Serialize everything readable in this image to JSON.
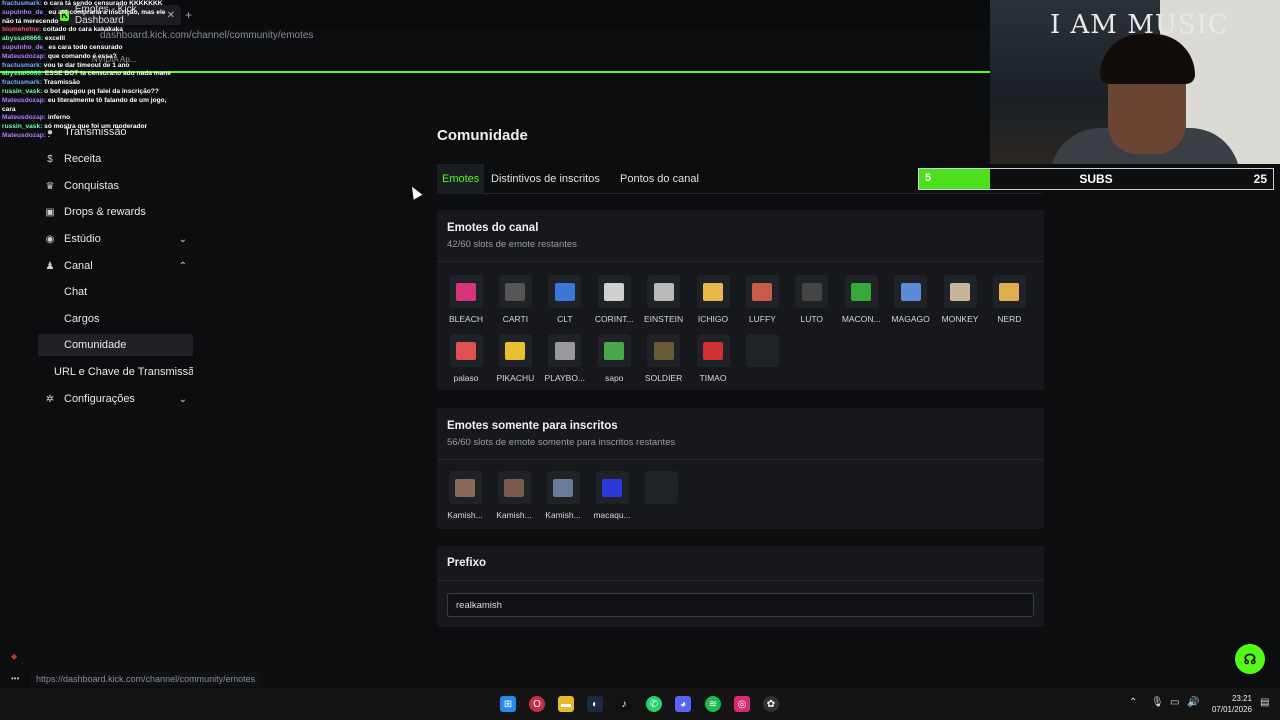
{
  "browser": {
    "tab_title": "Emotes - Kick Dashboard",
    "tab_close": "✕",
    "new_tab": "+",
    "url": "dashboard.kick.com/channel/community/emotes",
    "bookmark": "NVIDIA Ap..."
  },
  "sidebar": {
    "items": [
      {
        "label": "Transmissão",
        "icon": "broadcast-icon"
      },
      {
        "label": "Receita",
        "icon": "money-icon"
      },
      {
        "label": "Conquistas",
        "icon": "trophy-icon"
      },
      {
        "label": "Drops & rewards",
        "icon": "gift-icon"
      },
      {
        "label": "Estúdio",
        "icon": "studio-icon",
        "chevron": "⌄"
      },
      {
        "label": "Canal",
        "icon": "users-icon",
        "chevron": "⌃"
      },
      {
        "label": "Chat"
      },
      {
        "label": "Cargos"
      },
      {
        "label": "Comunidade"
      },
      {
        "label": "URL e Chave de Transmissã"
      },
      {
        "label": "Configurações",
        "icon": "gear-icon",
        "chevron": "⌄"
      }
    ]
  },
  "chat": [
    {
      "user": "fractusmark:",
      "text": "o cara tá sendo censurado KKKKKKK"
    },
    {
      "user": "supulnho_de_",
      "text": "eu até compraria a inscrição, mas ele não tá merecendo"
    },
    {
      "user": "biomehetne:",
      "text": "coitado do cara kakakaka"
    },
    {
      "user": "abyssal6666:",
      "text": "excelll"
    },
    {
      "user": "supulnho_de_",
      "text": "es cara todo censurado"
    },
    {
      "user": "Mateusdozap:",
      "text": "que comando é essa?"
    },
    {
      "user": "fractusmark:",
      "text": "vou te dar timeout de 1 ano"
    },
    {
      "user": "abyssal6666:",
      "text": "ESSE BOT ta censurano ado nada mane"
    },
    {
      "user": "fractusmark:",
      "text": "Trasmissão"
    },
    {
      "user": "russin_vask:",
      "text": "o bot apagou pq falei da inscrição??"
    },
    {
      "user": "Mateusdozap:",
      "text": "eu literalmente tô falando de um jogo, cara"
    },
    {
      "user": "Mateusdozap:",
      "text": "inferno"
    },
    {
      "user": "russin_vask:",
      "text": "só mostra que foi um moderador"
    },
    {
      "user": "Mateusdozap:",
      "text": "."
    }
  ],
  "main": {
    "title": "Comunidade",
    "tabs": [
      "Emotes",
      "Distintivos de inscritos",
      "Pontos do canal"
    ],
    "channel_emotes": {
      "title": "Emotes do canal",
      "subtitle": "42/60 slots de emote restantes",
      "emotes": [
        {
          "name": "BLEACH",
          "color": "#d8337a"
        },
        {
          "name": "CARTI",
          "color": "#555555"
        },
        {
          "name": "CLT",
          "color": "#3a78d8"
        },
        {
          "name": "CORINT...",
          "color": "#cfcfcf"
        },
        {
          "name": "EINSTEIN",
          "color": "#b9b9b9"
        },
        {
          "name": "ICHIGO",
          "color": "#e8b84a"
        },
        {
          "name": "LUFFY",
          "color": "#c95a4a"
        },
        {
          "name": "LUTO",
          "color": "#444444"
        },
        {
          "name": "MACON...",
          "color": "#39a83b"
        },
        {
          "name": "MAGAGO",
          "color": "#5a8ad8"
        },
        {
          "name": "MONKEY",
          "color": "#c8b49a"
        },
        {
          "name": "NERD",
          "color": "#e0b050"
        },
        {
          "name": "palaso",
          "color": "#e05050"
        },
        {
          "name": "PIKACHU",
          "color": "#e8c030"
        },
        {
          "name": "PLAYBO...",
          "color": "#999999"
        },
        {
          "name": "sapo",
          "color": "#4aa84a"
        },
        {
          "name": "SOLDIER",
          "color": "#6a5a3a"
        },
        {
          "name": "TIMAO",
          "color": "#d03030"
        },
        {
          "name": "",
          "color": "#1f2226"
        }
      ]
    },
    "sub_emotes": {
      "title": "Emotes somente para inscritos",
      "subtitle": "56/60 slots de emote somente para inscritos restantes",
      "emotes": [
        {
          "name": "Kamish...",
          "color": "#8a6a5a"
        },
        {
          "name": "Kamish...",
          "color": "#7a5a4a"
        },
        {
          "name": "Kamish...",
          "color": "#6a7a9a"
        },
        {
          "name": "macaqu...",
          "color": "#2a3ad8"
        },
        {
          "name": "",
          "color": "#1f2226"
        }
      ]
    },
    "prefix": {
      "title": "Prefixo",
      "value": "realkamish"
    }
  },
  "webcam": {
    "wall_text": "I AM MUSIC"
  },
  "subs_goal": {
    "current": "5",
    "label": "SUBS",
    "goal": "25",
    "progress": 0.2
  },
  "status_url": "https://dashboard.kick.com/channel/community/emotes",
  "taskbar": {
    "time": "23:21",
    "date": "07/01/2026"
  },
  "colors": {
    "accent": "#53fc18",
    "background": "#0b0d0f",
    "card": "#16181b"
  }
}
